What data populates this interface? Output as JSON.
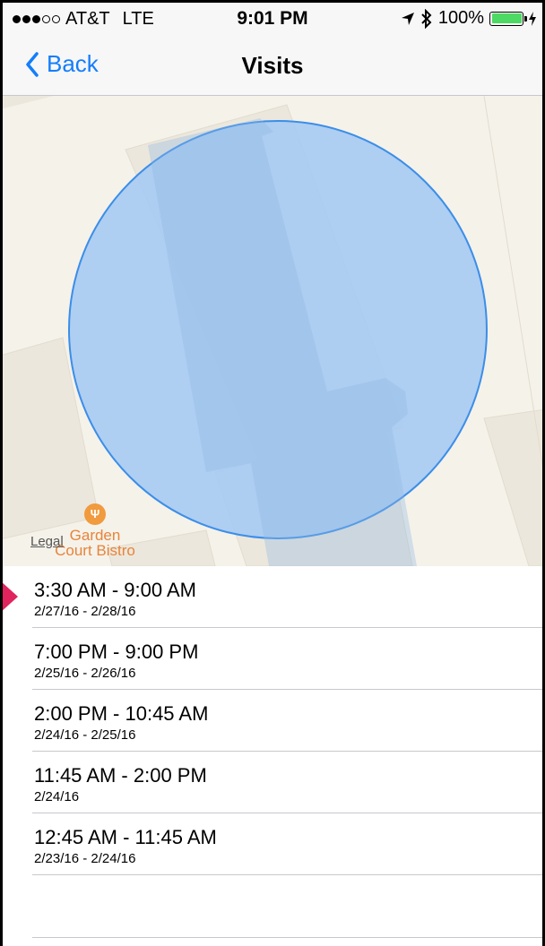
{
  "status_bar": {
    "carrier": "AT&T",
    "network": "LTE",
    "time": "9:01 PM",
    "battery": "100%",
    "signal_bars_filled": 3,
    "signal_bars_total": 5
  },
  "nav": {
    "back_label": "Back",
    "title": "Visits"
  },
  "map": {
    "legal_label": "Legal",
    "poi_label": "Garden Court Bistro"
  },
  "visits": [
    {
      "time": "3:30 AM - 9:00 AM",
      "date": "2/27/16 - 2/28/16"
    },
    {
      "time": "7:00 PM - 9:00 PM",
      "date": "2/25/16 - 2/26/16"
    },
    {
      "time": "2:00 PM - 10:45 AM",
      "date": "2/24/16 - 2/25/16"
    },
    {
      "time": "11:45 AM - 2:00 PM",
      "date": "2/24/16"
    },
    {
      "time": "12:45 AM - 11:45 AM",
      "date": "2/23/16 - 2/24/16"
    }
  ],
  "colors": {
    "accent": "#147efb",
    "battery": "#4cd964",
    "region_fill": "#a7cbf2",
    "region_stroke": "#3b8ee8",
    "poi": "#f19a3e",
    "marker": "#e0245e"
  }
}
